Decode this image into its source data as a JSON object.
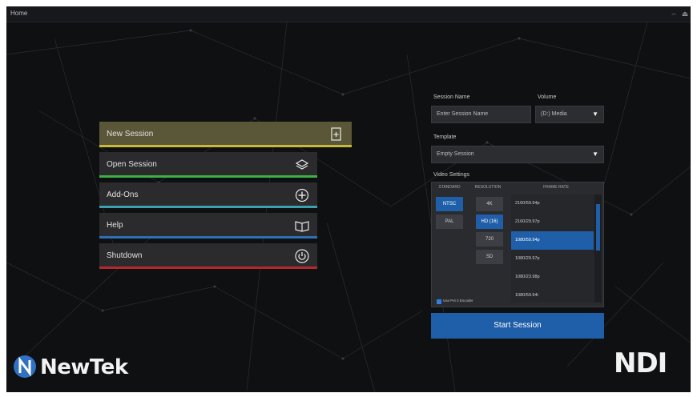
{
  "window": {
    "title": "Home",
    "eject_symbol": "⏏"
  },
  "menu": {
    "items": [
      {
        "label": "New Session",
        "icon": "new-session-icon",
        "color": "#c9b93a"
      },
      {
        "label": "Open Session",
        "icon": "stack-icon",
        "color": "#3fae45"
      },
      {
        "label": "Add-Ons",
        "icon": "plus-circle-icon",
        "color": "#3aa1b3"
      },
      {
        "label": "Help",
        "icon": "book-icon",
        "color": "#2f6fb3"
      },
      {
        "label": "Shutdown",
        "icon": "power-icon",
        "color": "#b3282e"
      }
    ]
  },
  "session": {
    "name_label": "Session Name",
    "name_placeholder": "Enter Session Name",
    "volume_label": "Volume",
    "volume_value": "(D:) Media",
    "template_label": "Template",
    "template_value": "Empty Session",
    "video_settings_label": "Video Settings",
    "columns": {
      "standard": "STANDARD",
      "resolution": "RESOLUTION",
      "frame_rate": "FRAME RATE"
    },
    "standards": [
      {
        "label": "NTSC",
        "selected": true
      },
      {
        "label": "PAL",
        "selected": false
      }
    ],
    "resolutions": [
      {
        "label": "4K",
        "selected": false
      },
      {
        "label": "HD (16)",
        "selected": true
      },
      {
        "label": "720",
        "selected": false
      },
      {
        "label": "SD",
        "selected": false
      }
    ],
    "rates": [
      {
        "label": "2160/59.94p",
        "selected": false
      },
      {
        "label": "2160/29.97p",
        "selected": false
      },
      {
        "label": "1080/59.94p",
        "selected": true
      },
      {
        "label": "1080/29.97p",
        "selected": false
      },
      {
        "label": "1080/23.98p",
        "selected": false
      },
      {
        "label": "1080/59.94i",
        "selected": false
      }
    ],
    "checkbox_label": "Use Pvt 3 Encoder",
    "checkbox_checked": true,
    "start_label": "Start Session"
  },
  "logos": {
    "newtek": "NewTek",
    "ndi": "NDI"
  },
  "colors": {
    "accent": "#1f5ea8",
    "background": "#0f1012"
  }
}
